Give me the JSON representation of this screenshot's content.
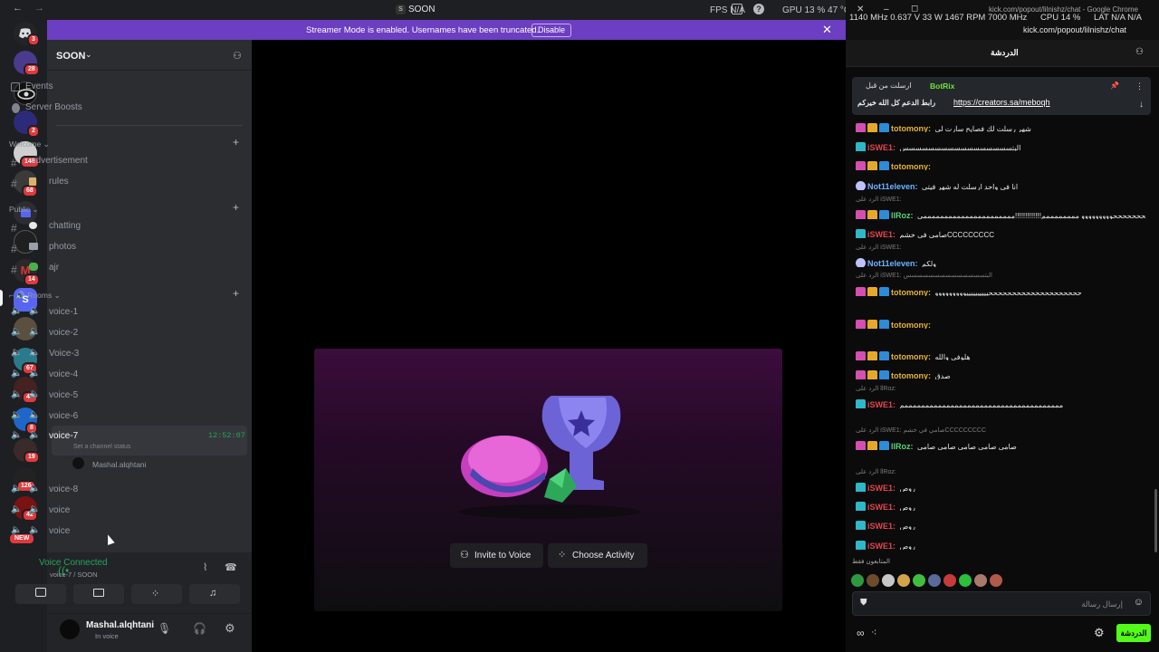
{
  "titlebar": {
    "title": "SOON",
    "server_letter": "S"
  },
  "perf": {
    "fps": "FPS  N/A",
    "gpu": "GPU  13 %  47 °C",
    "clock": "1140 MHz  0.637 V  33 W  1467 RPM  7000 MHz",
    "cpu": "CPU  14 %",
    "lat": "LAT  N/A  N/A"
  },
  "banner": {
    "text": "Streamer Mode is enabled. Usernames have been truncated.",
    "button": "Disable"
  },
  "server": {
    "name": "SOON"
  },
  "rail": [
    {
      "badge": "3"
    },
    {
      "badge": "28"
    },
    {
      "badge": ""
    },
    {
      "badge": "2"
    },
    {
      "badge": "148"
    },
    {
      "badge": "68"
    },
    {
      "badge": ""
    },
    {
      "badge": ""
    },
    {
      "badge": "14"
    },
    {
      "badge": ""
    },
    {
      "badge": ""
    },
    {
      "badge": "67"
    },
    {
      "badge": "47"
    },
    {
      "badge": "8"
    },
    {
      "badge": "19"
    },
    {
      "badge": "126"
    },
    {
      "badge": "42"
    },
    {
      "badge": "NEW"
    }
  ],
  "nav": {
    "events": "Events",
    "boosts": "Server Boosts"
  },
  "categories": {
    "welcome": "Welcome",
    "public": "Public",
    "rooms": "Rooms"
  },
  "channels": {
    "advertisement": "advertisement",
    "rules": "rules",
    "chatting": "chatting",
    "photos": "photos",
    "ajr": "ajr"
  },
  "voice_channels": [
    "voice-1",
    "voice-2",
    "Voice-3",
    "voice-4",
    "voice-5",
    "voice-6",
    "voice-7",
    "voice-8",
    "voice",
    "voice"
  ],
  "active_voice": {
    "timer": "12:52:07",
    "status": "Set a channel status",
    "member": "Mashal.alqhtani"
  },
  "voice_status": {
    "title": "Voice Connected",
    "sub": "voice-7 / SOON"
  },
  "user": {
    "name": "Mashal.alqhtani",
    "status": "In voice"
  },
  "main": {
    "invite": "Invite to Voice",
    "activity": "Choose Activity"
  },
  "kick": {
    "url": "kick.com/popout/lilnishz/chat",
    "window_title": "kick.com/popout/lilnishz/chat - Google Chrome",
    "header": "الدردشة",
    "pinned_by": "BotRix",
    "pinned_label": "ارسلت من قبل",
    "pinned_text": "رابط الدعم كل الله خيركم",
    "pinned_link": "https://creators.sa/meboqh",
    "placeholder": "إرسال رسالة",
    "send": "الدردشة",
    "emotes_label": "المتابعون فقط"
  },
  "messages": [
    {
      "name": "totomony:",
      "text": "شهر رسلت لك فصايح سارت لي",
      "color": "#e6b23a"
    },
    {
      "name": "iSWE1:",
      "text": "البتسسسسسسسسسسسسسسسسس",
      "color": "#e0454b"
    },
    {
      "name": "totomony:",
      "text": "",
      "color": "#e6b23a"
    },
    {
      "name": "Not11eleven:",
      "text": "انا في واحد ارسلت له شهر فيتي",
      "color": "#6fb2ff"
    },
    {
      "name": "llRoz:",
      "text": "حححححححححححححووووووووو ممممممممم!!!!!!!!!!!!!ممممممممممممممممممممممي",
      "color": "#59d67a",
      "reply": "الرد على  iSWE1:"
    },
    {
      "name": "iSWE1:",
      "text": "صامي في خشمCCCCCCCCC",
      "color": "#e0454b"
    },
    {
      "name": "Not11eleven:",
      "text": "ولكم",
      "color": "#6fb2ff",
      "reply": "الرد على  iSWE1:"
    },
    {
      "name": "totomony:",
      "text": "ححححححححححححححححححححييييييييييووووووووو",
      "color": "#e6b23a",
      "reply": "الرد على  iSWE1: البتسسسسسسسسسسسسسس"
    },
    {
      "name": "totomony:",
      "text": "",
      "color": "#e6b23a"
    },
    {
      "name": "totomony:",
      "text": "هلوفي والله",
      "color": "#e6b23a"
    },
    {
      "name": "totomony:",
      "text": "صدق",
      "color": "#e6b23a"
    },
    {
      "name": "iSWE1:",
      "text": "ممممممممممممممممممممممممممممممممممممممم",
      "color": "#e0454b",
      "reply": "الرد على  llRoz:"
    },
    {
      "name": "llRoz:",
      "text": "صامي صامي صامي صامي صامي",
      "color": "#59d67a",
      "reply": "الرد على  iSWE1: صامي في خشمCCCCCCCCC"
    },
    {
      "name": "iSWE1:",
      "text": "روص",
      "color": "#e0454b",
      "reply": "الرد على  llRoz:"
    },
    {
      "name": "iSWE1:",
      "text": "روص",
      "color": "#e0454b"
    },
    {
      "name": "iSWE1:",
      "text": "روص",
      "color": "#e0454b"
    },
    {
      "name": "iSWE1:",
      "text": "روص",
      "color": "#e0454b"
    }
  ]
}
